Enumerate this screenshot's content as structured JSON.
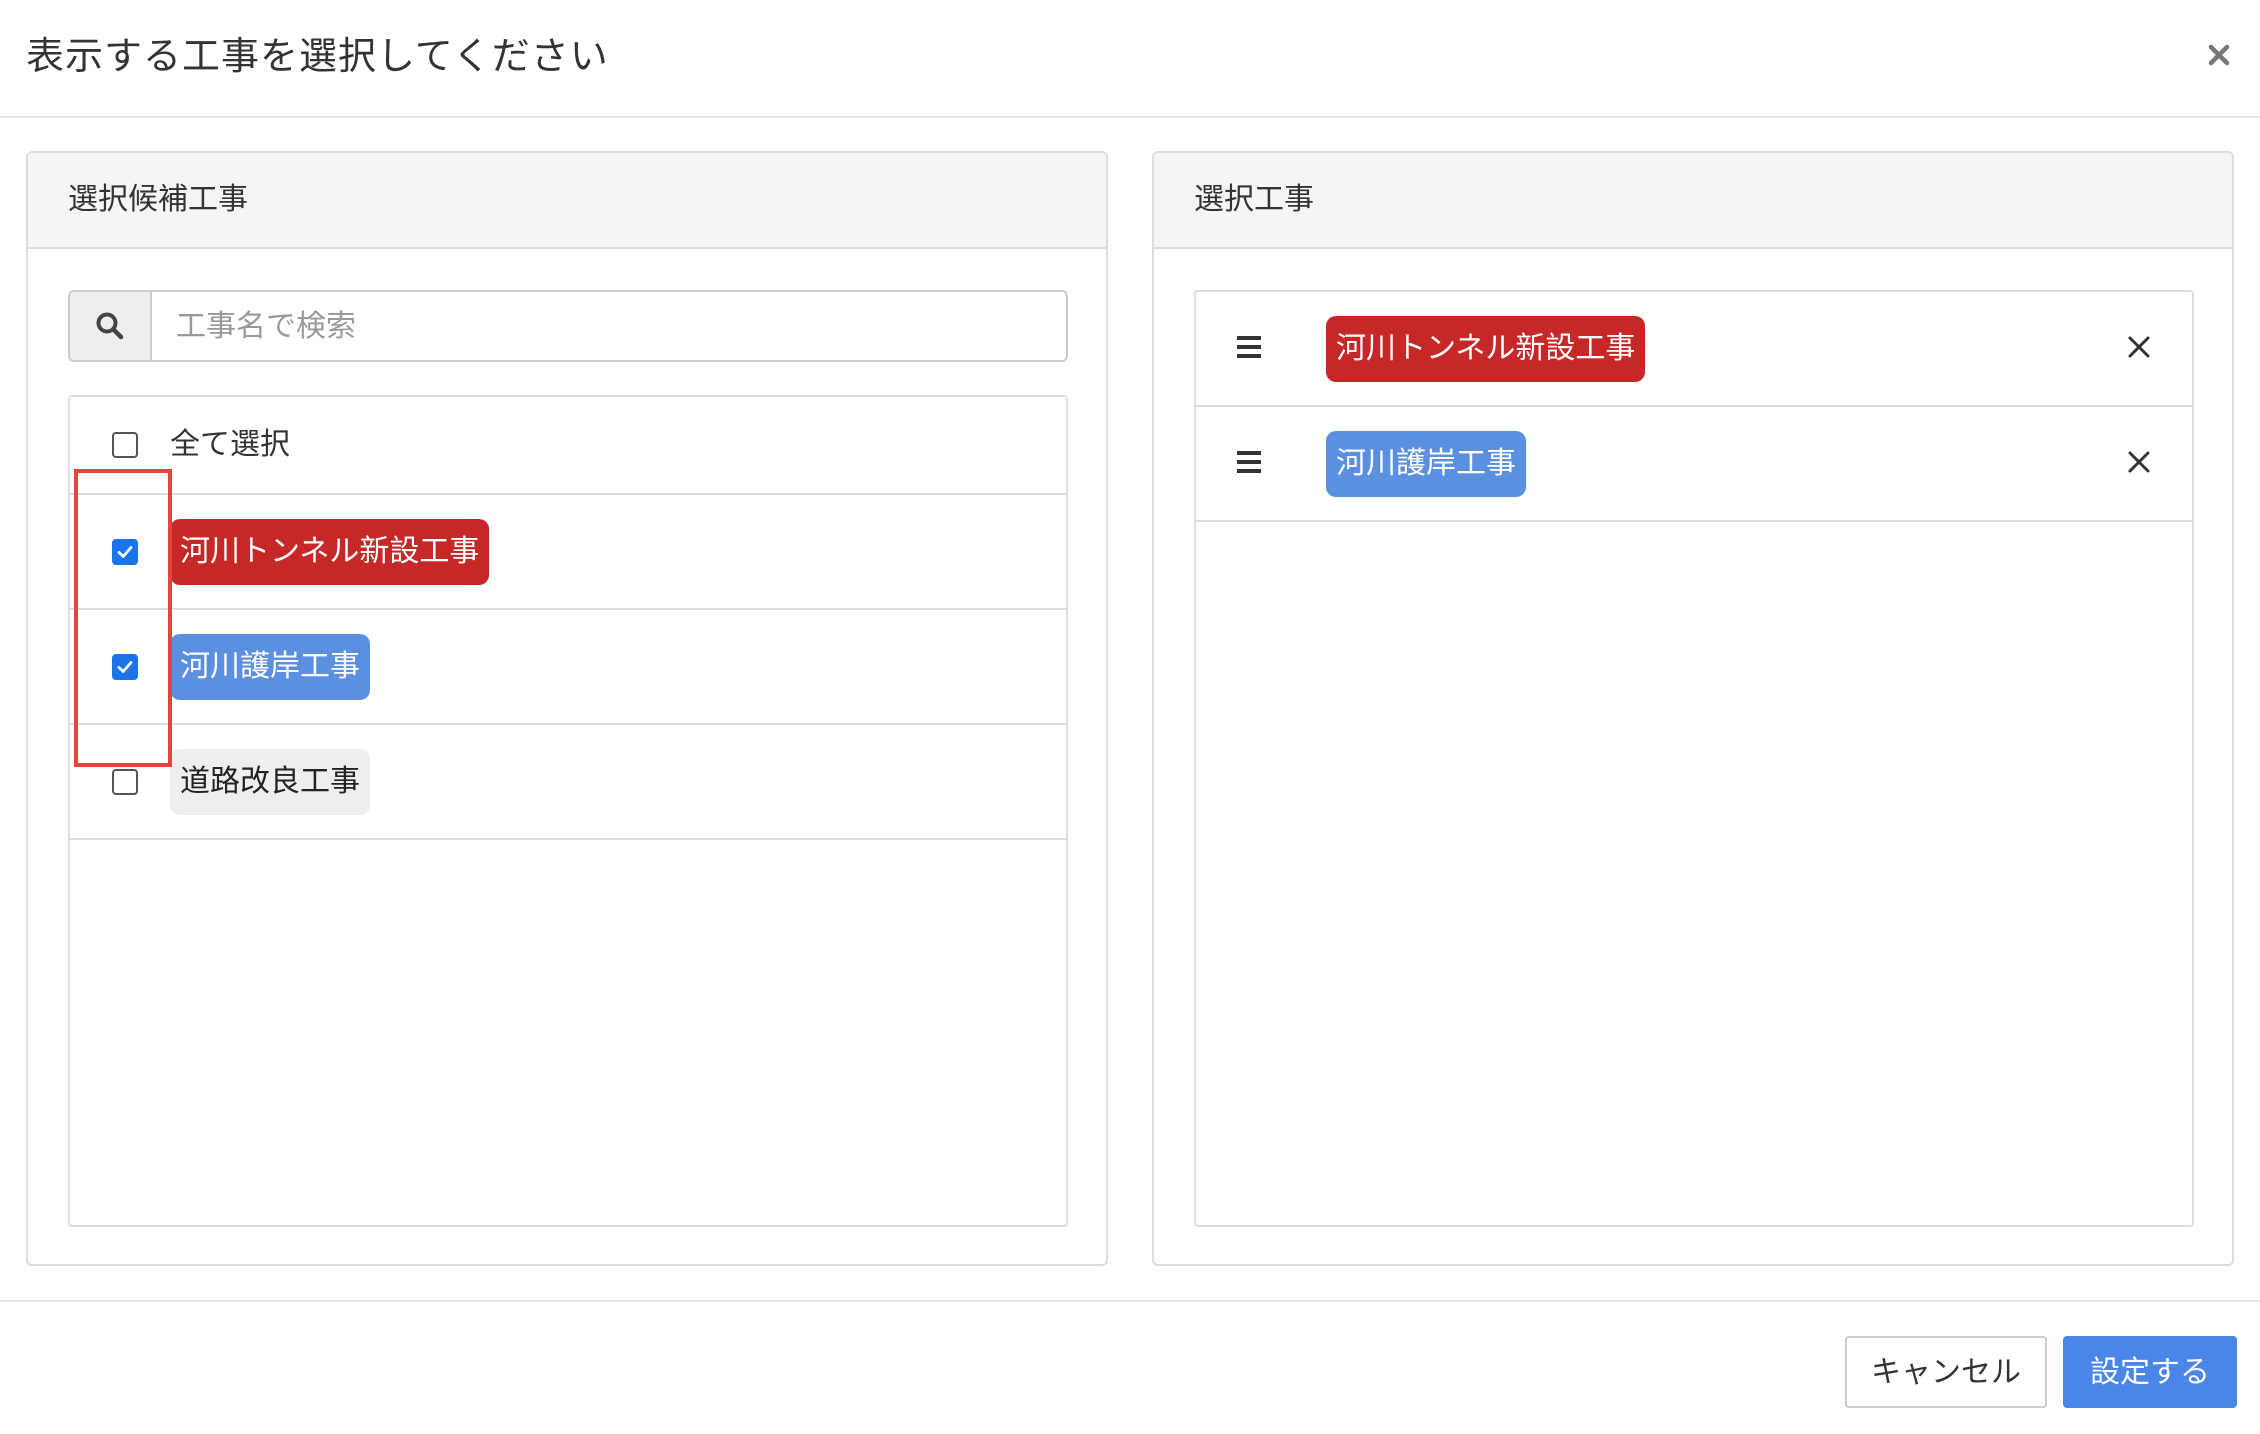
{
  "modal": {
    "title": "表示する工事を選択してください",
    "close_icon": "close-icon"
  },
  "candidates": {
    "heading": "選択候補工事",
    "search": {
      "placeholder": "工事名で検索",
      "value": "",
      "icon": "search-icon"
    },
    "select_all": {
      "label": "全て選択",
      "checked": false
    },
    "items": [
      {
        "label": "河川トンネル新設工事",
        "checked": true,
        "color": "#c62828"
      },
      {
        "label": "河川護岸工事",
        "checked": true,
        "color": "#5b8fe0"
      },
      {
        "label": "道路改良工事",
        "checked": false,
        "color": "#eeeeee"
      }
    ]
  },
  "selected": {
    "heading": "選択工事",
    "items": [
      {
        "label": "河川トンネル新設工事",
        "color": "#c62828",
        "handle_icon": "drag-handle-icon",
        "remove_icon": "remove-icon"
      },
      {
        "label": "河川護岸工事",
        "color": "#5b8fe0",
        "handle_icon": "drag-handle-icon",
        "remove_icon": "remove-icon"
      }
    ]
  },
  "footer": {
    "cancel_label": "キャンセル",
    "submit_label": "設定する",
    "submit_color": "#4a86e8"
  },
  "annotation": {
    "highlight_color": "#e5443a"
  }
}
